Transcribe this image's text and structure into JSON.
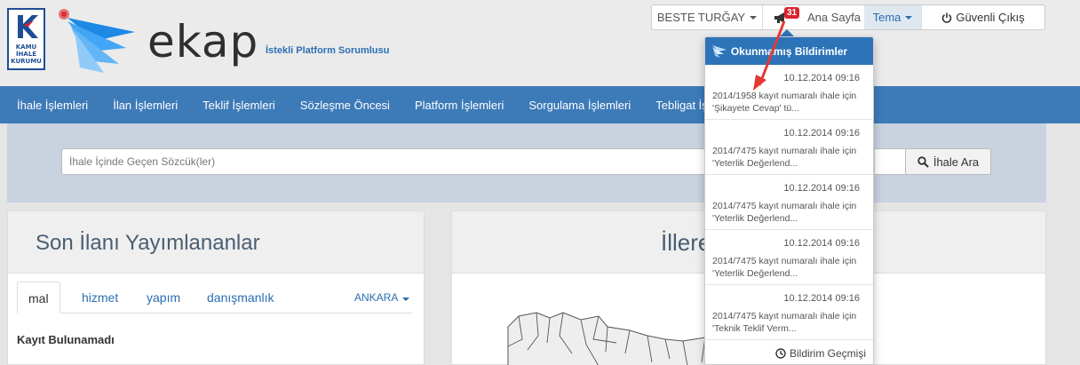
{
  "brand": {
    "kik_text": [
      "KAMU",
      "İHALE",
      "KURUMU"
    ],
    "name": "ekap",
    "subtitle": "İstekli Platform Sorumlusu"
  },
  "topnav": {
    "user": "BESTE TURĞAY",
    "notification_count": "31",
    "home": "Ana Sayfa",
    "theme": "Tema",
    "logout": "Güvenli Çıkış"
  },
  "mainmenu": [
    "İhale İşlemleri",
    "İlan İşlemleri",
    "Teklif İşlemleri",
    "Sözleşme Öncesi",
    "Platform İşlemleri",
    "Sorgulama İşlemleri",
    "Tebligat İş"
  ],
  "search": {
    "placeholder": "İhale İçinde Geçen Sözcük(ler)",
    "button": "İhale Ara"
  },
  "left_panel": {
    "title": "Son İlanı Yayımlananlar",
    "tabs": [
      "mal",
      "hizmet",
      "yapım",
      "danışmanlık"
    ],
    "city": "ANKARA",
    "empty": "Kayıt Bulunamadı"
  },
  "right_panel": {
    "title": "İllere"
  },
  "notifications": {
    "title": "Okunmamış Bildirimler",
    "items": [
      {
        "date": "10.12.2014 09:16",
        "text": "2014/1958 kayıt numaralı ihale için 'Şikayete Cevap' tü..."
      },
      {
        "date": "10.12.2014 09:16",
        "text": "2014/7475 kayıt numaralı ihale için 'Yeterlik Değerlend..."
      },
      {
        "date": "10.12.2014 09:16",
        "text": "2014/7475 kayıt numaralı ihale için 'Yeterlik Değerlend..."
      },
      {
        "date": "10.12.2014 09:16",
        "text": "2014/7475 kayıt numaralı ihale için 'Yeterlik Değerlend..."
      },
      {
        "date": "10.12.2014 09:16",
        "text": "2014/7475 kayıt numaralı ihale için 'Teknik Teklif Verm..."
      }
    ],
    "footer": "Bildirim Geçmişi"
  },
  "colors": {
    "menu_bg": "#3d7ab8",
    "accent": "#2c73b8",
    "badge": "#d9232d",
    "arrow": "#e53935"
  }
}
